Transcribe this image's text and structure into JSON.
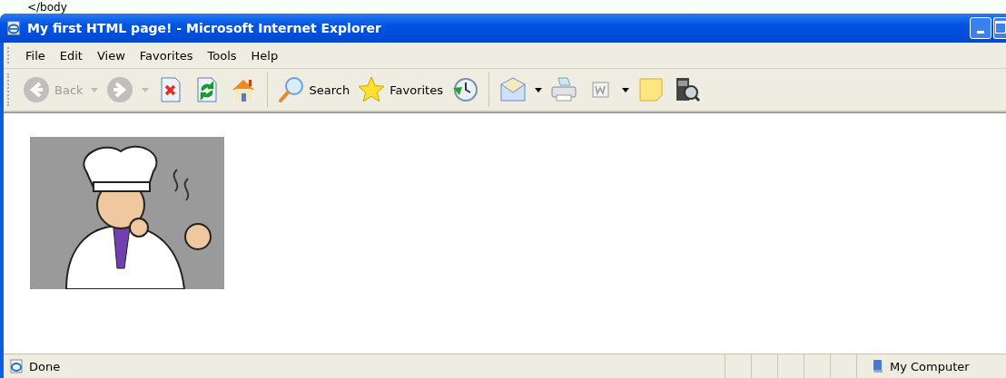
{
  "page_fragment": "</body",
  "window": {
    "title": "My first HTML page! - Microsoft Internet Explorer"
  },
  "menu": [
    "File",
    "Edit",
    "View",
    "Favorites",
    "Tools",
    "Help"
  ],
  "toolbar": [
    {
      "kind": "back",
      "label": "Back",
      "disabled": true,
      "dropdown": true
    },
    {
      "kind": "forward",
      "disabled": true,
      "dropdown": true
    },
    {
      "kind": "stop",
      "disabled": false,
      "dropdown": false
    },
    {
      "kind": "refresh",
      "disabled": false,
      "dropdown": false
    },
    {
      "kind": "home",
      "disabled": false,
      "dropdown": false
    },
    {
      "kind": "separator"
    },
    {
      "kind": "search",
      "label": "Search",
      "disabled": false,
      "dropdown": false
    },
    {
      "kind": "favorites",
      "label": "Favorites",
      "disabled": false,
      "dropdown": false
    },
    {
      "kind": "history",
      "disabled": false,
      "dropdown": false
    },
    {
      "kind": "separator"
    },
    {
      "kind": "mail",
      "disabled": false,
      "dropdown": true
    },
    {
      "kind": "print",
      "disabled": false,
      "dropdown": false
    },
    {
      "kind": "edit",
      "disabled": false,
      "dropdown": true
    },
    {
      "kind": "note",
      "disabled": false,
      "dropdown": false
    },
    {
      "kind": "research",
      "disabled": false,
      "dropdown": false
    }
  ],
  "status_bar": {
    "text": "Done",
    "zone": "My Computer"
  }
}
